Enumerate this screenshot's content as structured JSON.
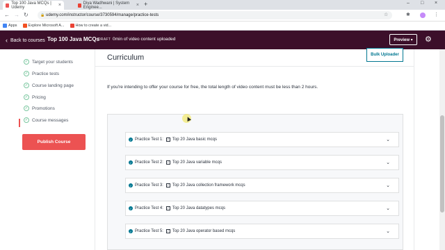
{
  "browser": {
    "tabs": [
      {
        "title": "Top 100 Java MCQs | Udemy",
        "close": "×",
        "favicon_color": "#ec5252"
      },
      {
        "title": "Diya Wadhwani | System Enginee...",
        "close": "×",
        "favicon_color": "#ea4335"
      }
    ],
    "new_tab": "+",
    "window_controls": [
      "–",
      "□",
      "×"
    ],
    "nav": {
      "back": "←",
      "forward": "→",
      "reload": "↻"
    },
    "url": "udemy.com/instructor/course/3730594/manage/practice-tests",
    "bookmarks": [
      {
        "label": "Apps",
        "color": "#4285f4"
      },
      {
        "label": "Explore Microsoft A...",
        "color": "#f25022"
      },
      {
        "label": "How to create a vid...",
        "color": "#ea4335"
      }
    ]
  },
  "header": {
    "back_label": "Back to courses",
    "course_title": "Top 100 Java MCQs",
    "status": "DRAFT",
    "video_info": "0min of video content uploaded",
    "preview_label": "Preview ▾",
    "accent": "#3c0f2a"
  },
  "sidebar": {
    "items": [
      {
        "label": "Target your students"
      },
      {
        "label": "Practice tests"
      },
      {
        "label": "Course landing page"
      },
      {
        "label": "Pricing"
      },
      {
        "label": "Promotions"
      },
      {
        "label": "Course messages"
      }
    ],
    "publish_label": "Publish Course",
    "publish_color": "#ec5252"
  },
  "main": {
    "title": "Curriculum",
    "bulk_uploader": "Bulk Uploader",
    "notice": "If you're intending to offer your course for free, the total length of video content must be less than 2 hours.",
    "tests": [
      {
        "prefix": "Practice Test 1:",
        "name": "Top 20 Java basic mcqs"
      },
      {
        "prefix": "Practice Test 2:",
        "name": "Top 20 Java variable mcqs"
      },
      {
        "prefix": "Practice Test 3:",
        "name": "Top 20 Java collection framework mcqs"
      },
      {
        "prefix": "Practice Test 4:",
        "name": "Top 20 Java datatypes mcqs"
      },
      {
        "prefix": "Practice Test 5:",
        "name": "Top 20 Java operator based mcqs"
      }
    ]
  }
}
